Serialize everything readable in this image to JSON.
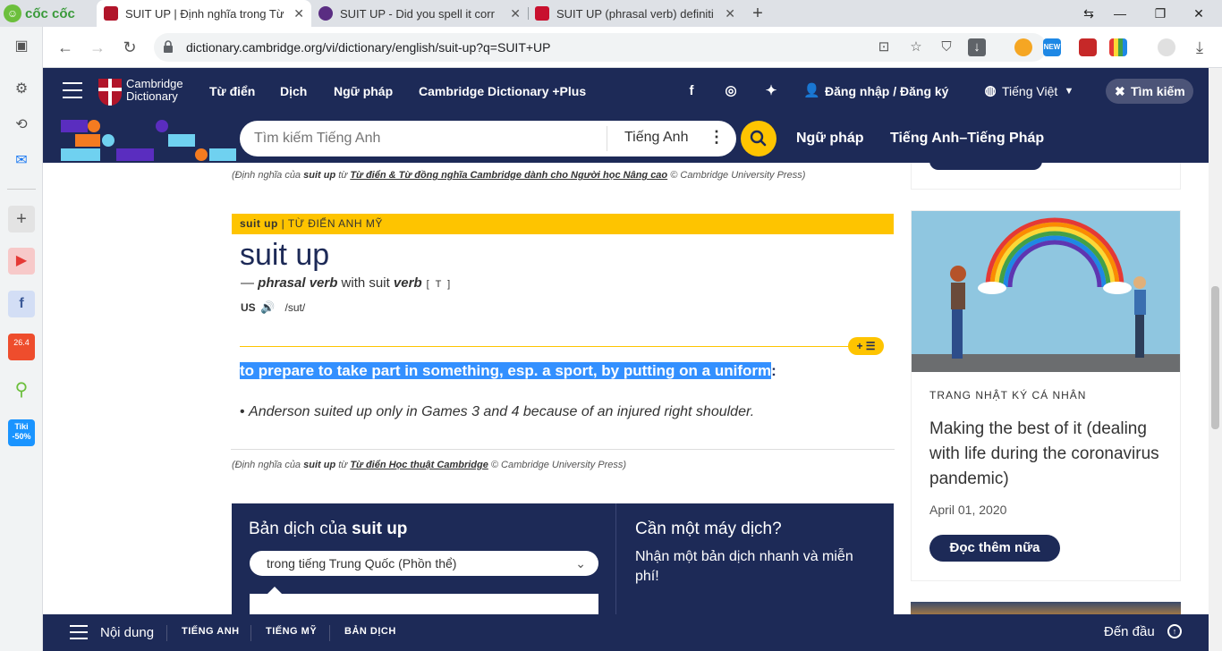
{
  "browser": {
    "brand": "cốc cốc",
    "tabs": [
      {
        "title": "SUIT UP | Định nghĩa trong Từ",
        "close": "✕"
      },
      {
        "title": "SUIT UP - Did you spell it corr",
        "close": "✕"
      },
      {
        "title": "SUIT UP (phrasal verb) definiti",
        "close": "✕"
      }
    ],
    "new_tab": "+",
    "url": "dictionary.cambridge.org/vi/dictionary/english/suit-up?q=SUIT+UP",
    "ext_new_badge": "NEW",
    "left_badges": {
      "shopee": "26.4",
      "tiki_line1": "Tiki",
      "tiki_line2": "-50%"
    }
  },
  "header": {
    "logo_line1": "Cambridge",
    "logo_line2": "Dictionary",
    "nav": [
      "Từ điển",
      "Dịch",
      "Ngữ pháp",
      "Cambridge Dictionary +Plus"
    ],
    "login": "Đăng nhập / Đăng ký",
    "language": "Tiếng Việt",
    "search_toggle": "Tìm kiếm"
  },
  "search": {
    "placeholder": "Tìm kiếm Tiếng Anh",
    "dictionary": "Tiếng Anh",
    "links": [
      "Ngữ pháp",
      "Tiếng Anh–Tiếng Pháp"
    ]
  },
  "entry": {
    "credit_top": {
      "prefix": "(Định nghĩa của ",
      "word": "suit up",
      "mid": " từ ",
      "source": "Từ điển & Từ đồng nghĩa Cambridge dành cho Người học Nâng cao",
      "suffix": " © Cambridge University Press)"
    },
    "section_word": "suit up",
    "section_label": " | TỪ ĐIỂN ANH MỸ",
    "headword": "suit up",
    "pos_dash": "— ",
    "pos": "phrasal verb",
    "with_text": " with suit ",
    "verb": "verb",
    "grammar": " [ T ]",
    "region": "US",
    "ipa": "/sut/",
    "badge": "+ ☰",
    "definition": "to prepare to take part in something, esp. a sport, by putting on a uniform",
    "definition_colon": ":",
    "example_bullet": "• ",
    "example": "Anderson suited up only in Games 3 and 4 because of an injured right shoulder.",
    "credit_bottom": {
      "prefix": "(Định nghĩa của ",
      "word": "suit up",
      "mid": " từ ",
      "source": "Từ điển Học thuật Cambridge",
      "suffix": " © Cambridge University Press)"
    }
  },
  "translation": {
    "title_prefix": "Bản dịch của ",
    "title_word": "suit up",
    "select_value": "trong tiếng Trung Quốc (Phồn thể)",
    "need_title": "Cần một máy dịch?",
    "need_text": "Nhận một bản dịch nhanh và miễn phí!"
  },
  "sidebar_card": {
    "kicker": "TRANG NHẬT KÝ CÁ NHÂN",
    "headline": "Making the best of it (dealing with life during the coronavirus pandemic)",
    "date": "April 01, 2020",
    "button": "Đọc thêm nữa"
  },
  "bottombar": {
    "contents": "Nội dung",
    "tabs": [
      "TIẾNG ANH",
      "TIẾNG MỸ",
      "BẢN DỊCH"
    ],
    "to_top": "Đến đầu"
  },
  "colors": {
    "navy": "#1d2a57",
    "yellow": "#fec400",
    "highlight": "#3390ff",
    "cambridge_red": "#b1152a"
  }
}
